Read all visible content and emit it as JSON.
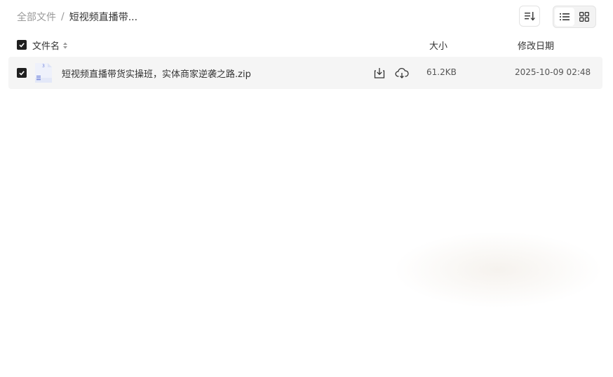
{
  "breadcrumb": {
    "root": "全部文件",
    "separator": "/",
    "current": "短视频直播带..."
  },
  "toolbar": {
    "sort_icon": "sort-icon",
    "list_view_icon": "list-view-icon",
    "grid_view_icon": "grid-view-icon",
    "active_view": "list"
  },
  "table": {
    "headers": {
      "name": "文件名",
      "size": "大小",
      "date": "修改日期"
    },
    "rows": [
      {
        "name": "短视频直播带货实操班，实体商家逆袭之路.zip",
        "size": "61.2KB",
        "date": "2025-10-09 02:48",
        "checked": true,
        "icon": "zip-file-icon"
      }
    ]
  },
  "colors": {
    "checkbox": "#1f1f1f",
    "row_bg": "#f5f5f5",
    "muted_text": "#9a9a9a",
    "file_icon_accent": "#6a7ed8"
  }
}
